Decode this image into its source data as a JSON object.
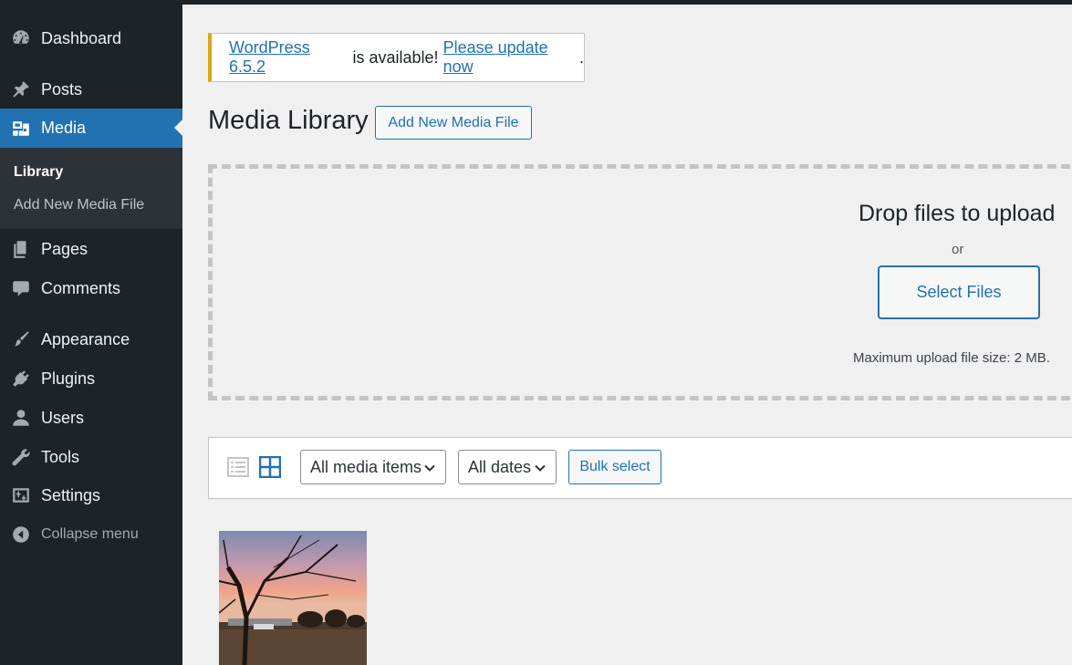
{
  "sidebar": {
    "items": [
      {
        "label": "Dashboard",
        "icon": "dashboard-icon"
      },
      {
        "label": "Posts",
        "icon": "pushpin-icon"
      },
      {
        "label": "Media",
        "icon": "media-icon",
        "active": true
      },
      {
        "label": "Pages",
        "icon": "pages-icon"
      },
      {
        "label": "Comments",
        "icon": "comment-icon"
      },
      {
        "label": "Appearance",
        "icon": "paintbrush-icon"
      },
      {
        "label": "Plugins",
        "icon": "plugin-icon"
      },
      {
        "label": "Users",
        "icon": "user-icon"
      },
      {
        "label": "Tools",
        "icon": "wrench-icon"
      },
      {
        "label": "Settings",
        "icon": "settings-icon"
      }
    ],
    "submenu": [
      {
        "label": "Library",
        "current": true
      },
      {
        "label": "Add New Media File"
      }
    ],
    "collapse_label": "Collapse menu"
  },
  "notice": {
    "link1": "WordPress 6.5.2",
    "middle": " is available! ",
    "link2": "Please update now",
    "end": "."
  },
  "header": {
    "title": "Media Library",
    "add_new_label": "Add New Media File"
  },
  "uploader": {
    "title": "Drop files to upload",
    "or": "or",
    "select_label": "Select Files",
    "max_size": "Maximum upload file size: 2 MB."
  },
  "filters": {
    "media_type": "All media items",
    "dates": "All dates",
    "bulk_label": "Bulk select"
  },
  "colors": {
    "accent": "#2271b1",
    "sidebar_bg": "#1d2327",
    "notice_warning": "#dba617"
  }
}
